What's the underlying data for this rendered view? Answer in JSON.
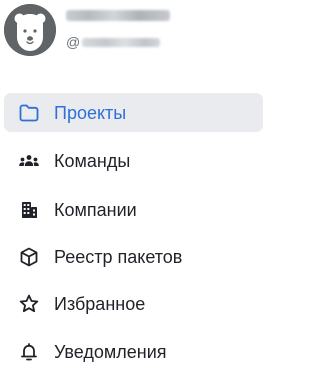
{
  "profile": {
    "handle_prefix": "@"
  },
  "nav": {
    "items": [
      {
        "label": "Проекты",
        "icon": "folder-icon",
        "active": true
      },
      {
        "label": "Команды",
        "icon": "team-icon",
        "active": false
      },
      {
        "label": "Компании",
        "icon": "building-icon",
        "active": false
      },
      {
        "label": "Реестр пакетов",
        "icon": "package-icon",
        "active": false
      },
      {
        "label": "Избранное",
        "icon": "star-icon",
        "active": false
      },
      {
        "label": "Уведомления",
        "icon": "bell-icon",
        "active": false
      }
    ]
  },
  "colors": {
    "accent": "#2f6fd6",
    "active_background": "#e9ebef",
    "text": "#1f2328",
    "avatar_background": "#606467"
  }
}
